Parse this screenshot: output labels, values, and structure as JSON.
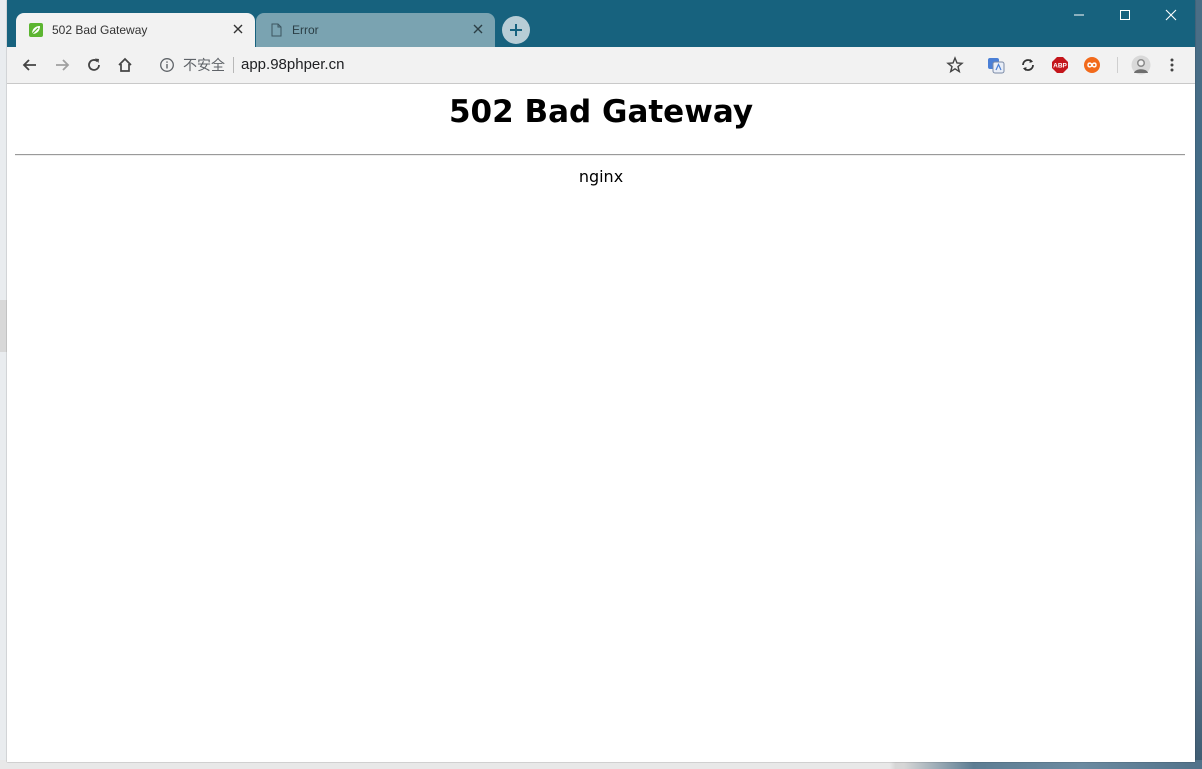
{
  "browser": {
    "tabs": [
      {
        "title": "502 Bad Gateway",
        "favicon": "leaf-icon",
        "active": true
      },
      {
        "title": "Error",
        "favicon": "page-icon",
        "active": false
      }
    ],
    "address_bar": {
      "security_label": "不安全",
      "url": "app.98phper.cn"
    },
    "extensions": [
      "translate-icon",
      "sync-icon",
      "adblock-icon",
      "infinity-icon"
    ],
    "extension_labels": {
      "adblock": "ABP"
    },
    "colors": {
      "titlebar": "#17627e",
      "toolbar": "#f2f2f2",
      "inactive_tab": "#7aa3b1"
    }
  },
  "page": {
    "heading": "502 Bad Gateway",
    "server": "nginx"
  }
}
